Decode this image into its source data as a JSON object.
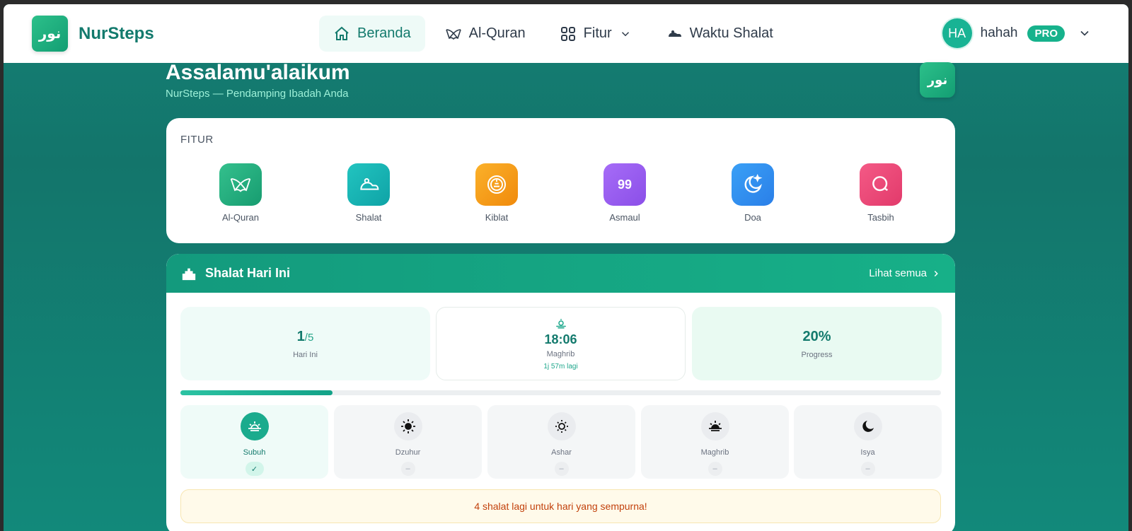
{
  "app": {
    "brand_name": "NurSteps",
    "logo_text": "نور"
  },
  "nav": {
    "items": [
      {
        "label": "Beranda",
        "icon": "home-icon",
        "active": true
      },
      {
        "label": "Al-Quran",
        "icon": "quran-icon"
      },
      {
        "label": "Fitur",
        "icon": "grid-icon"
      },
      {
        "label": "Waktu Shalat",
        "icon": "prayer-mat-icon"
      }
    ]
  },
  "user": {
    "initials": "HA",
    "name": "hahah",
    "badge": "PRO"
  },
  "hero": {
    "title": "Assalamu'alaikum",
    "subtitle": "NurSteps — Pendamping Ibadah Anda",
    "logo_text": "نور"
  },
  "features": {
    "label": "FITUR",
    "items": [
      {
        "label": "Al-Quran",
        "icon": "quran-icon",
        "color": "#22b07d"
      },
      {
        "label": "Shalat",
        "icon": "prayer-icon",
        "color": "#15b3b3"
      },
      {
        "label": "Kiblat",
        "icon": "compass-icon",
        "color": "#f59a14"
      },
      {
        "label": "Asmaul",
        "icon": "number-99-icon",
        "text": "99",
        "color": "#9b5cf6"
      },
      {
        "label": "Doa",
        "icon": "moon-star-icon",
        "color": "#2f8ff0"
      },
      {
        "label": "Tasbih",
        "icon": "tasbih-icon",
        "color": "#ee4a7a"
      }
    ]
  },
  "prayer_today": {
    "title": "Shalat Hari Ini",
    "see_all": "Lihat semua",
    "stats": {
      "done_count": "1",
      "done_total": "/5",
      "done_label": "Hari Ini",
      "next_time": "18:06",
      "next_name": "Maghrib",
      "next_remaining": "1j 57m lagi",
      "progress_text": "20%",
      "progress_label": "Progress"
    },
    "progress": 0.2,
    "prayers": [
      {
        "name": "Subuh",
        "icon": "sunrise-icon",
        "done": true,
        "status": "✓"
      },
      {
        "name": "Dzuhur",
        "icon": "sun-icon",
        "done": false,
        "status": "–"
      },
      {
        "name": "Ashar",
        "icon": "sun-low-icon",
        "done": false,
        "status": "–"
      },
      {
        "name": "Maghrib",
        "icon": "sunset-icon",
        "done": false,
        "status": "–"
      },
      {
        "name": "Isya",
        "icon": "moon-icon",
        "done": false,
        "status": "–"
      }
    ],
    "notice": "4 shalat lagi untuk hari yang sempurna!"
  },
  "colors": {
    "primary": "#137a6d",
    "accent": "#17b28c",
    "warning_text": "#c2410c"
  }
}
